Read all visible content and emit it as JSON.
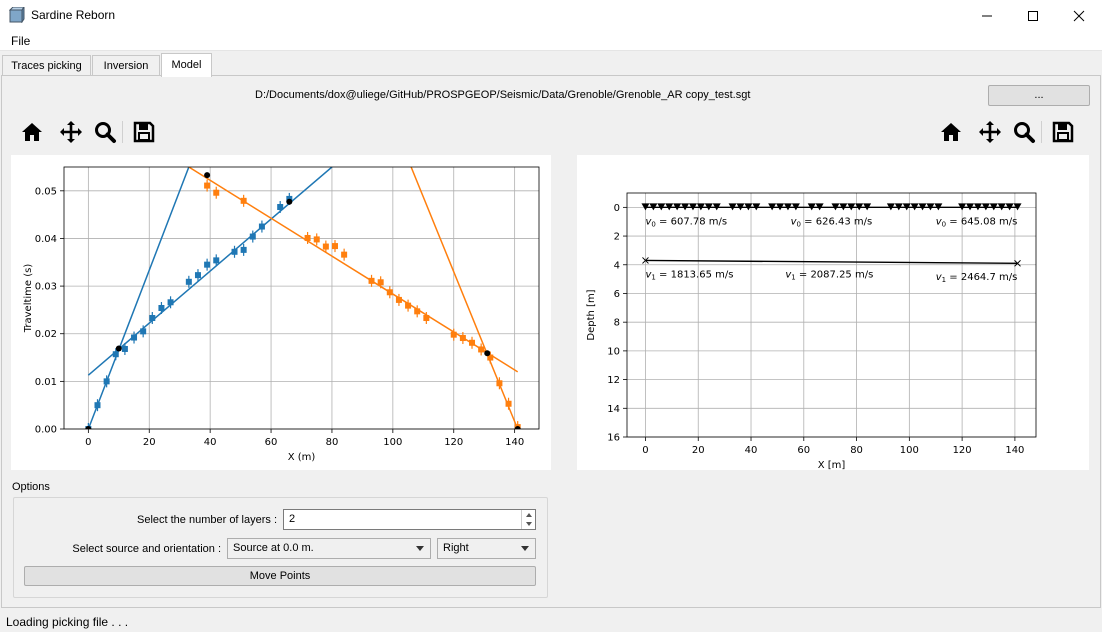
{
  "window": {
    "title": "Sardine Reborn",
    "controls": [
      "minimize-icon",
      "maximize-icon",
      "close-icon"
    ]
  },
  "menu": {
    "file": "File"
  },
  "tabs": [
    {
      "label": "Traces picking",
      "active": false
    },
    {
      "label": "Inversion",
      "active": false
    },
    {
      "label": "Model",
      "active": true
    }
  ],
  "model": {
    "file_path": "D:/Documents/dox@uliege/GitHub/PROSPGEOP/Seismic/Data/Grenoble/Grenoble_AR copy_test.sgt",
    "browse_label": "...",
    "toolbar_icons": [
      "home-icon",
      "pan-icon",
      "zoom-icon",
      "save-icon"
    ]
  },
  "options": {
    "group_label": "Options",
    "layers_label": "Select the number of layers :",
    "layers_value": "2",
    "source_label": "Select source and orientation :",
    "source_value": "Source at 0.0 m.",
    "orientation_value": "Right",
    "move_points_label": "Move Points"
  },
  "status": {
    "text": "Loading picking file . . ."
  },
  "colors": {
    "blue": "#1f77b4",
    "orange": "#ff7f0e",
    "black": "#000000"
  },
  "chart_data": [
    {
      "type": "scatter",
      "xlabel": "X (m)",
      "ylabel": "Traveltime (s)",
      "xlim": [
        -8,
        148
      ],
      "ylim": [
        0,
        0.055
      ],
      "xticks": [
        "0",
        "20",
        "40",
        "60",
        "80",
        "100",
        "120",
        "140"
      ],
      "yticks": [
        "0.00",
        "0.01",
        "0.02",
        "0.03",
        "0.04",
        "0.05"
      ],
      "grid": true,
      "series": [
        {
          "color": "#1f77b4",
          "points": [
            [
              0,
              0
            ],
            [
              3,
              0.005
            ],
            [
              6,
              0.01
            ],
            [
              9,
              0.0157
            ],
            [
              12,
              0.0168
            ],
            [
              15,
              0.0192
            ],
            [
              18,
              0.0205
            ],
            [
              21,
              0.0233
            ],
            [
              24,
              0.0254
            ],
            [
              27,
              0.0266
            ],
            [
              33,
              0.0309
            ],
            [
              36,
              0.0323
            ],
            [
              39,
              0.0345
            ],
            [
              42,
              0.0354
            ],
            [
              48,
              0.0372
            ],
            [
              51,
              0.0376
            ],
            [
              54,
              0.0404
            ],
            [
              57,
              0.0425
            ],
            [
              63,
              0.0466
            ],
            [
              66,
              0.0483
            ]
          ]
        },
        {
          "color": "#ff7f0e",
          "points": [
            [
              39,
              0.0511
            ],
            [
              42,
              0.0496
            ],
            [
              51,
              0.0479
            ],
            [
              72,
              0.0401
            ],
            [
              75,
              0.0398
            ],
            [
              78,
              0.0383
            ],
            [
              81,
              0.0384
            ],
            [
              84,
              0.0366
            ],
            [
              93,
              0.0311
            ],
            [
              96,
              0.0308
            ],
            [
              99,
              0.0287
            ],
            [
              102,
              0.0271
            ],
            [
              105,
              0.0259
            ],
            [
              108,
              0.0247
            ],
            [
              111,
              0.0233
            ],
            [
              120,
              0.0198
            ],
            [
              123,
              0.0191
            ],
            [
              126,
              0.0181
            ],
            [
              129,
              0.0167
            ],
            [
              132,
              0.015
            ],
            [
              135,
              0.0096
            ],
            [
              138,
              0.0053
            ],
            [
              141,
              0.0004
            ]
          ]
        }
      ],
      "lines": [
        {
          "color": "#1f77b4",
          "points": [
            [
              0,
              0
            ],
            [
              33,
              0.055
            ]
          ]
        },
        {
          "color": "#1f77b4",
          "points": [
            [
              0,
              0.0113
            ],
            [
              80,
              0.055
            ]
          ]
        },
        {
          "color": "#ff7f0e",
          "points": [
            [
              33,
              0.055
            ],
            [
              141,
              0.012
            ]
          ]
        },
        {
          "color": "#ff7f0e",
          "points": [
            [
              106,
              0.055
            ],
            [
              141,
              0
            ]
          ]
        }
      ],
      "breakpoints": [
        [
          0,
          0
        ],
        [
          10,
          0.0169
        ],
        [
          39,
          0.0533
        ],
        [
          66,
          0.0477
        ],
        [
          131,
          0.0159
        ],
        [
          141,
          0
        ]
      ]
    },
    {
      "type": "line",
      "xlabel": "X [m]",
      "ylabel": "Depth [m]",
      "xlim": [
        -7,
        148
      ],
      "ylim": [
        16,
        -1
      ],
      "xticks": [
        "0",
        "20",
        "40",
        "60",
        "80",
        "100",
        "120",
        "140"
      ],
      "yticks": [
        "0",
        "2",
        "4",
        "6",
        "8",
        "10",
        "12",
        "14",
        "16"
      ],
      "grid": true,
      "geophones_x": [
        0,
        3,
        6,
        9,
        12,
        15,
        18,
        21,
        24,
        27,
        33,
        36,
        39,
        42,
        48,
        51,
        54,
        57,
        63,
        66,
        72,
        75,
        78,
        81,
        84,
        93,
        96,
        99,
        102,
        105,
        108,
        111,
        120,
        123,
        126,
        129,
        132,
        135,
        138,
        141
      ],
      "interfaces": [
        {
          "points": [
            [
              0,
              0
            ],
            [
              141,
              0
            ]
          ]
        },
        {
          "points": [
            [
              0,
              3.7
            ],
            [
              141,
              3.9
            ]
          ]
        }
      ],
      "annotations": [
        {
          "sym": "v",
          "sub": "0",
          "text": " = 607.78 m/s",
          "x": 0,
          "y": 0.9
        },
        {
          "sym": "v",
          "sub": "0",
          "text": " = 626.43 m/s",
          "x": 55,
          "y": 0.9
        },
        {
          "sym": "v",
          "sub": "0",
          "text": " = 645.08 m/s",
          "x": 110,
          "y": 0.9
        },
        {
          "sym": "v",
          "sub": "1",
          "text": " = 1813.65 m/s",
          "x": 0,
          "y": 4.6
        },
        {
          "sym": "v",
          "sub": "1",
          "text": " = 2087.25 m/s",
          "x": 53,
          "y": 4.6
        },
        {
          "sym": "v",
          "sub": "1",
          "text": " = 2464.7 m/s",
          "x": 110,
          "y": 4.8
        }
      ]
    }
  ]
}
